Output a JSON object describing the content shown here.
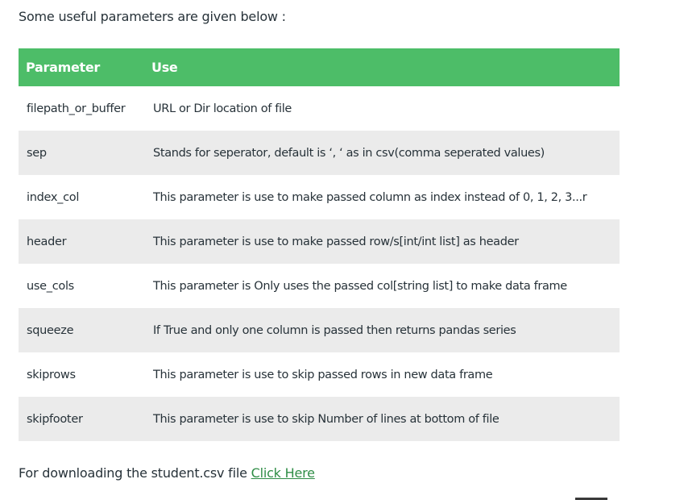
{
  "intro_text": "Some useful parameters are given below :",
  "table": {
    "headers": [
      "Parameter",
      "Use"
    ],
    "rows": [
      {
        "param": "filepath_or_buffer",
        "use": "URL or Dir location of file"
      },
      {
        "param": "sep",
        "use": "Stands for seperator, default is ‘, ‘ as in csv(comma seperated values)"
      },
      {
        "param": "index_col",
        "use": "This parameter is use to make passed column as index instead of 0, 1, 2, 3...r"
      },
      {
        "param": "header",
        "use": "This parameter is use to make passed row/s[int/int list] as header"
      },
      {
        "param": "use_cols",
        "use": "This parameter is Only uses the passed col[string list] to make data frame"
      },
      {
        "param": "squeeze",
        "use": "If True and only one column is passed then returns pandas series"
      },
      {
        "param": "skiprows",
        "use": "This parameter is use to skip passed rows in new data frame"
      },
      {
        "param": "skipfooter",
        "use": "This parameter is use to skip Number of lines at bottom of file"
      }
    ]
  },
  "download": {
    "text": "For downloading the student.csv file",
    "link_label": "Click Here"
  },
  "colors": {
    "header_bg": "#4dbd68",
    "stripe_bg": "#ebebeb",
    "link": "#2f8d46",
    "text": "#273239"
  }
}
